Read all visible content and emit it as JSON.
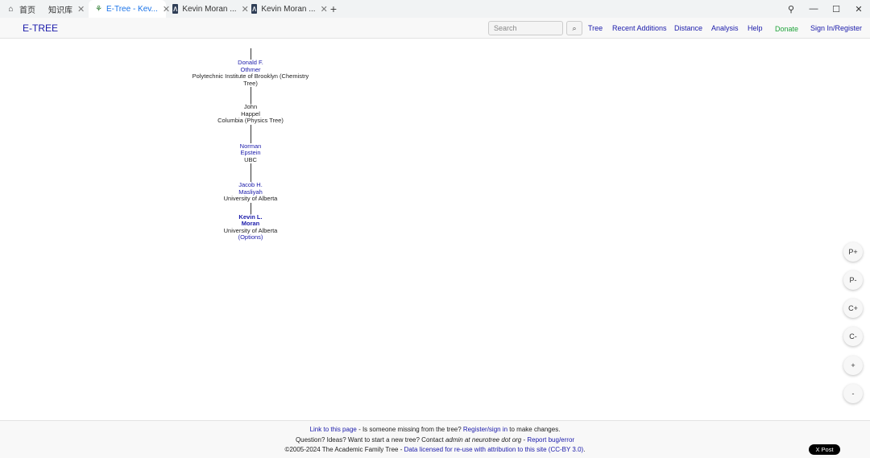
{
  "browser": {
    "tabs": [
      {
        "label": "首页",
        "icon": "home-icon"
      },
      {
        "label": "知识库",
        "icon": ""
      },
      {
        "label": "E-Tree - Kev...",
        "icon": "etree-favicon"
      },
      {
        "label": "Kevin Moran ...",
        "icon": "km-favicon"
      },
      {
        "label": "Kevin Moran ...",
        "icon": "km-favicon"
      }
    ],
    "new_tab": "+",
    "window_controls": {
      "pin": "⚲",
      "minimize": "—",
      "maximize": "☐",
      "close": "✕"
    }
  },
  "site": {
    "brand": "E-TREE",
    "search_placeholder": "Search",
    "search_button": "⌕",
    "nav": [
      "Tree",
      "Recent Additions",
      "Distance",
      "Analysis",
      "Help"
    ],
    "donate": "Donate",
    "signin": "Sign In/Register"
  },
  "tree": [
    {
      "name_line1": "Donald F.",
      "name_line2": "Othmer",
      "institution": "Polytechnic Institute of Brooklyn (Chemistry Tree)",
      "linked": true
    },
    {
      "name_line1": "John",
      "name_line2": "Happel",
      "institution": "Columbia (Physics Tree)",
      "linked": false
    },
    {
      "name_line1": "Norman",
      "name_line2": "Epstein",
      "institution": "UBC",
      "linked": true
    },
    {
      "name_line1": "Jacob H.",
      "name_line2": "Masliyah",
      "institution": "University of Alberta",
      "linked": true
    },
    {
      "name_line1": "Kevin L.",
      "name_line2": "Moran",
      "institution": "University of Alberta",
      "options": "(Options)",
      "current": true
    }
  ],
  "controls": [
    "P+",
    "P-",
    "C+",
    "C-",
    "+",
    "-"
  ],
  "footer": {
    "line1_link": "Link to this page",
    "line1_mid": " - Is someone missing from the tree? ",
    "line1_link2": "Register/sign in",
    "line1_end": " to make changes.",
    "line2_start": "Question? Ideas? Want to start a new tree? Contact ",
    "line2_email": "admin at neurotree dot org",
    "line2_sep": " - ",
    "line2_link": "Report bug/error",
    "line3_start": "©2005-2024 The Academic Family Tree - ",
    "line3_link": "Data licensed for re-use with attribution to this site (CC-BY 3.0)",
    "line3_end": ".",
    "x_post": "X Post"
  }
}
